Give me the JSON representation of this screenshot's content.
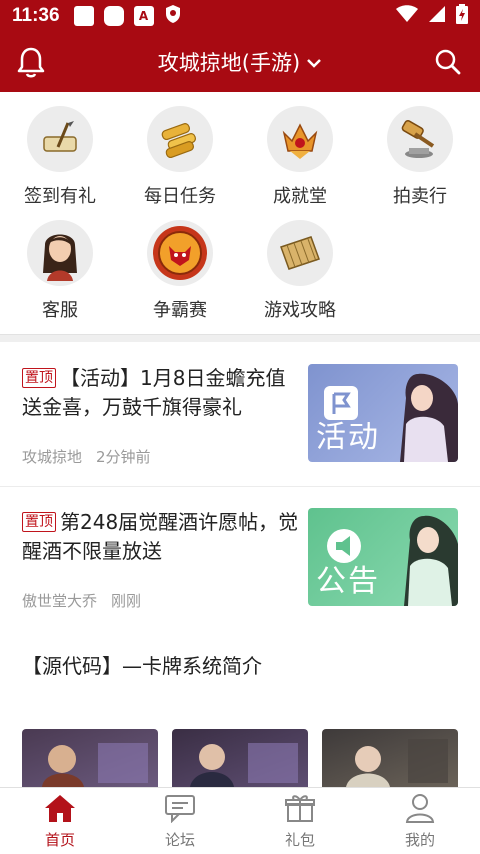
{
  "status": {
    "time": "11:36"
  },
  "header": {
    "title": "攻城掠地(手游)"
  },
  "grid": [
    {
      "label": "签到有礼",
      "icon": "scroll-quill-icon"
    },
    {
      "label": "每日任务",
      "icon": "gold-scrolls-icon"
    },
    {
      "label": "成就堂",
      "icon": "crown-badge-icon"
    },
    {
      "label": "拍卖行",
      "icon": "gavel-icon"
    },
    {
      "label": "客服",
      "icon": "female-avatar-icon"
    },
    {
      "label": "争霸赛",
      "icon": "tiger-emblem-icon"
    },
    {
      "label": "游戏攻略",
      "icon": "bamboo-scroll-icon"
    }
  ],
  "articles": [
    {
      "pin": "置顶",
      "title": "【活动】1月8日金蟾充值送金喜，万鼓千旗得豪礼",
      "author": "攻城掠地",
      "time": "2分钟前",
      "thumb_label": "活动",
      "thumb_color": "#7f93cf"
    },
    {
      "pin": "置顶",
      "title": "第248届觉醒酒许愿帖，觉醒酒不限量放送",
      "author": "傲世堂大乔",
      "time": "刚刚",
      "thumb_label": "公告",
      "thumb_color": "#5fc28e"
    }
  ],
  "source_article": {
    "title": "【源代码】—卡牌系统简介"
  },
  "bottom_nav": [
    {
      "label": "首页",
      "icon": "home-icon",
      "active": true
    },
    {
      "label": "论坛",
      "icon": "forum-icon",
      "active": false
    },
    {
      "label": "礼包",
      "icon": "gift-icon",
      "active": false
    },
    {
      "label": "我的",
      "icon": "user-icon",
      "active": false
    }
  ],
  "colors": {
    "brand": "#a80a12",
    "pin": "#c0141c",
    "active_nav": "#b3121a"
  }
}
